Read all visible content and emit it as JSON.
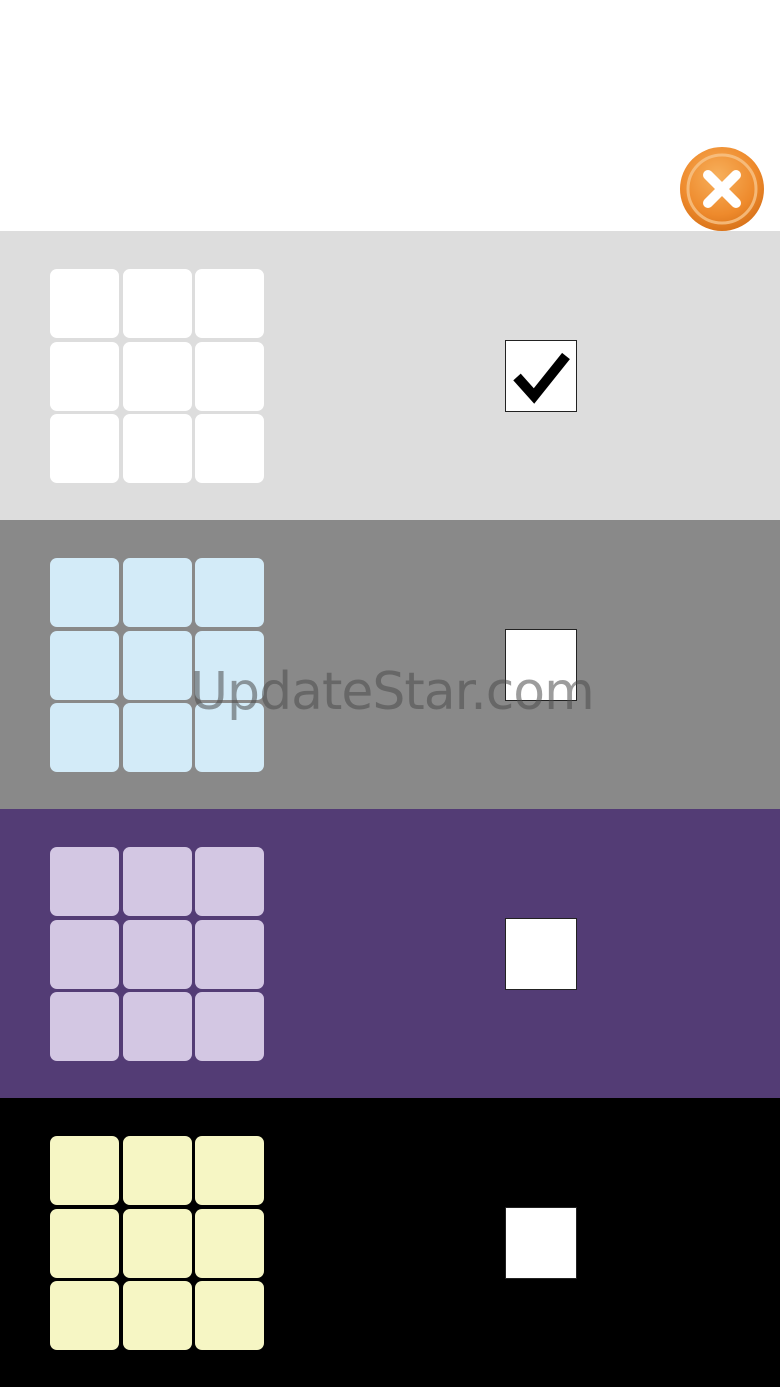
{
  "close_button": {
    "icon": "close-icon",
    "colors": {
      "ring": "#ee8a2c",
      "center": "#f39b3f",
      "glyph": "#ffffff"
    }
  },
  "themes": [
    {
      "id": "light",
      "background": "#dddddd",
      "tile_color": "#ffffff",
      "checked": true
    },
    {
      "id": "gray",
      "background": "#898989",
      "tile_color": "#d3ebf8",
      "checked": false
    },
    {
      "id": "purple",
      "background": "#533c75",
      "tile_color": "#d3c7e3",
      "checked": false
    },
    {
      "id": "dark",
      "background": "#000000",
      "tile_color": "#f6f6c4",
      "checked": false
    }
  ],
  "watermark": {
    "text": "UpdateStar.com"
  }
}
